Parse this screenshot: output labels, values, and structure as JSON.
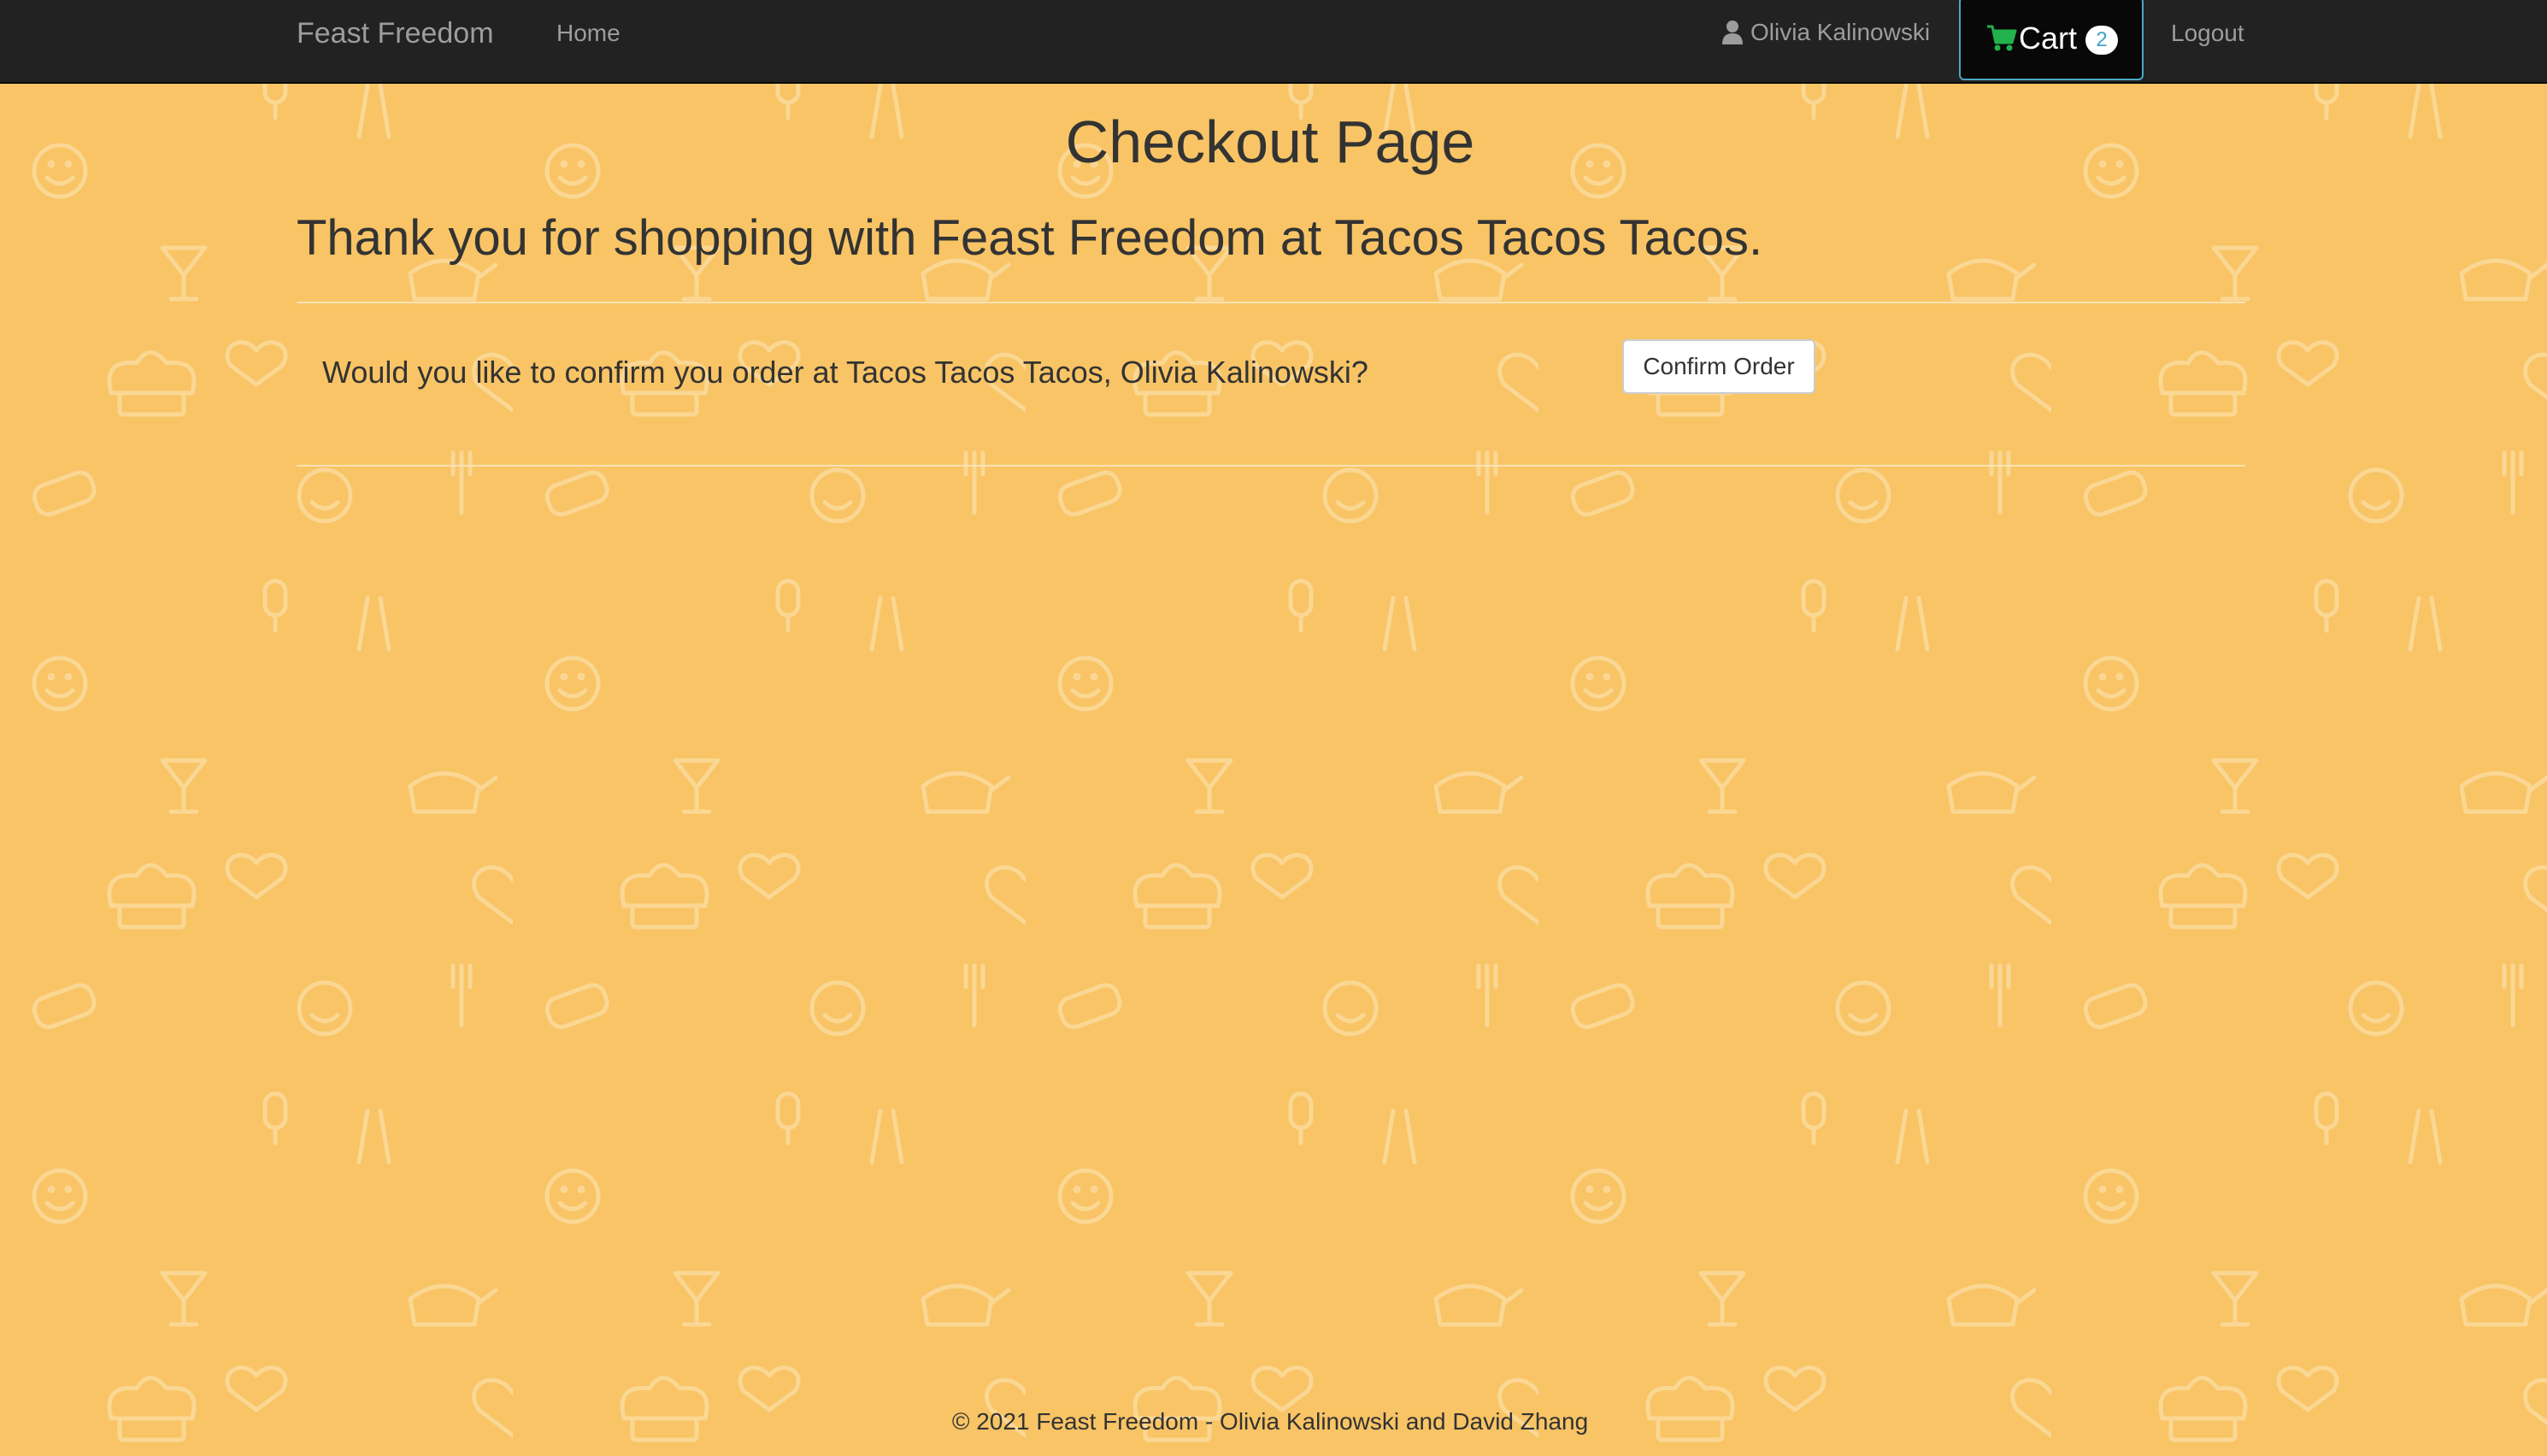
{
  "navbar": {
    "brand": "Feast Freedom",
    "home_label": "Home",
    "user_name": "Olivia Kalinowski",
    "cart_label": "Cart",
    "cart_count": "2",
    "logout_label": "Logout",
    "icons": {
      "user": "user-icon",
      "cart": "shopping-cart-icon"
    }
  },
  "main": {
    "title": "Checkout Page",
    "thank_you": "Thank you for shopping with Feast Freedom at Tacos Tacos Tacos.",
    "confirm_question": "Would you like to confirm you order at Tacos Tacos Tacos, Olivia Kalinowski?",
    "confirm_button": "Confirm Order"
  },
  "footer": {
    "text": "© 2021 Feast Freedom - Olivia Kalinowski and David Zhang"
  },
  "colors": {
    "background": "#F8C465",
    "navbar": "#222222",
    "cart_border": "#4AA7C4",
    "cart_icon": "#22B14C",
    "text": "#333333"
  }
}
